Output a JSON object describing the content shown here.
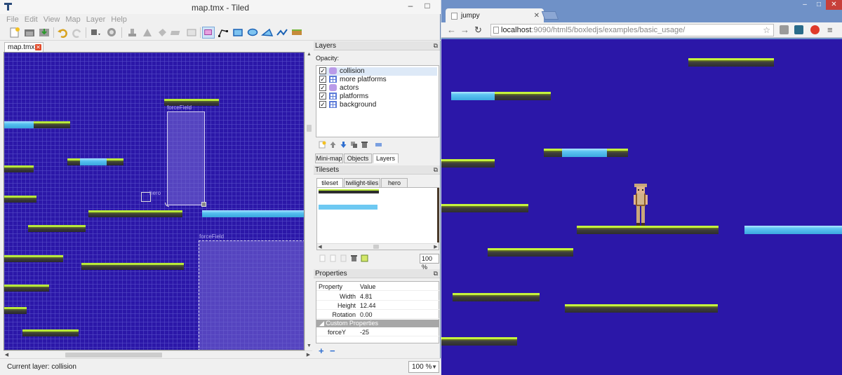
{
  "tiled": {
    "title": "map.tmx - Tiled",
    "menu": [
      "File",
      "Edit",
      "View",
      "Map",
      "Layer",
      "Help"
    ],
    "document_tab": "map.tmx",
    "map_objects": {
      "forcefield_1": "forceField",
      "forcefield_2": "forceField",
      "hero": "hero"
    },
    "layers_panel": {
      "title": "Layers",
      "opacity_label": "Opacity:",
      "layers": [
        {
          "name": "collision",
          "type": "object",
          "visible": true
        },
        {
          "name": "more platforms",
          "type": "tile",
          "visible": true
        },
        {
          "name": "actors",
          "type": "object",
          "visible": true
        },
        {
          "name": "platforms",
          "type": "tile",
          "visible": true
        },
        {
          "name": "background",
          "type": "tile",
          "visible": true
        }
      ],
      "tabs": [
        "Mini-map",
        "Objects",
        "Layers"
      ],
      "selected_tab": "Layers"
    },
    "tilesets_panel": {
      "title": "Tilesets",
      "tabs": [
        "tileset",
        "twilight-tiles",
        "hero"
      ],
      "selected_tab": "tileset",
      "zoom": "100 %"
    },
    "properties_panel": {
      "title": "Properties",
      "header_property": "Property",
      "header_value": "Value",
      "rows": [
        {
          "key": "Width",
          "value": "4.81"
        },
        {
          "key": "Height",
          "value": "12.44"
        },
        {
          "key": "Rotation",
          "value": "0.00"
        }
      ],
      "custom_header": "Custom Properties",
      "custom_rows": [
        {
          "key": "forceY",
          "value": "-25"
        }
      ]
    },
    "status": {
      "current_layer": "Current layer: collision",
      "zoom": "100 %"
    },
    "colors": {
      "map_bg": "#2b17a8",
      "grass": "#b8e83a",
      "ice": "#55bff0"
    }
  },
  "browser": {
    "tab_title": "jumpy",
    "url_host": "localhost",
    "url_path": ":9090/html5/boxledjs/examples/basic_usage/",
    "icons": [
      "back-icon",
      "forward-icon",
      "reload-icon",
      "star-icon",
      "menu-icon"
    ]
  }
}
